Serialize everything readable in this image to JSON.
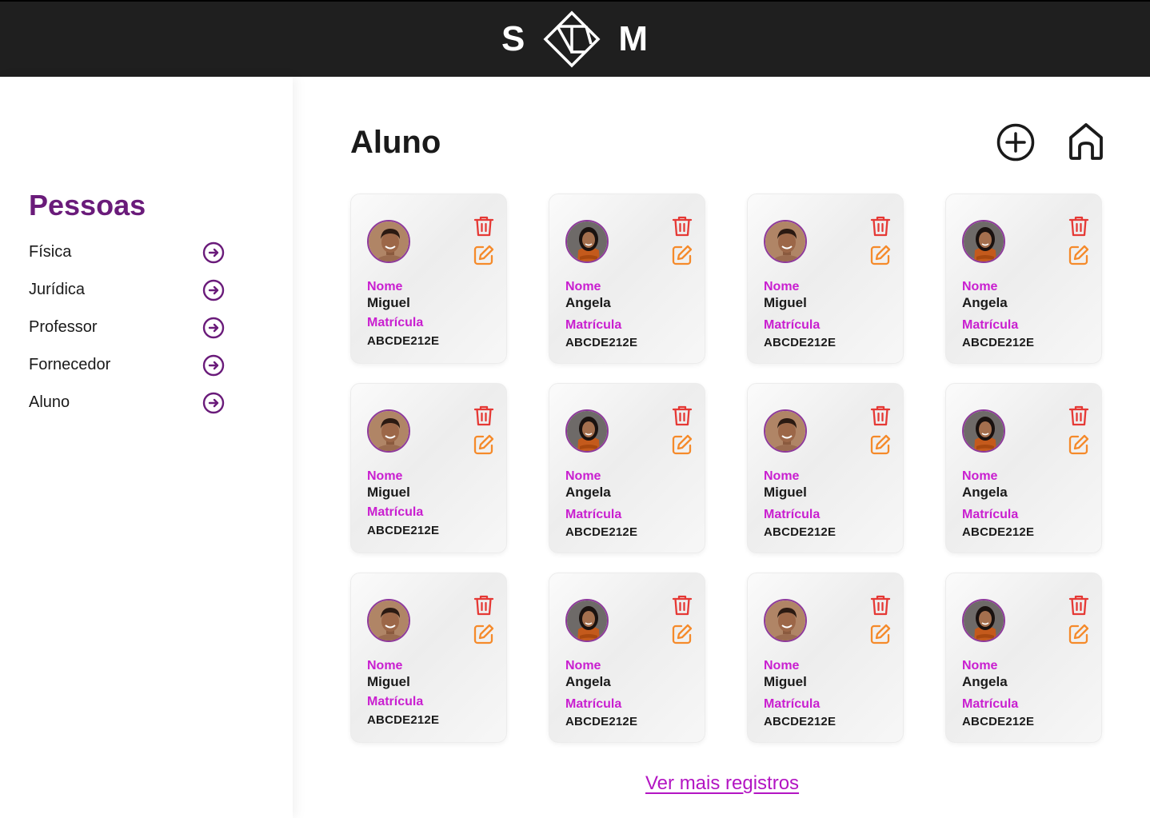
{
  "header": {
    "logo_left": "S",
    "logo_right": "M"
  },
  "sidebar": {
    "title": "Pessoas",
    "items": [
      {
        "label": "Física"
      },
      {
        "label": "Jurídica"
      },
      {
        "label": "Professor"
      },
      {
        "label": "Fornecedor"
      },
      {
        "label": "Aluno"
      }
    ]
  },
  "main": {
    "title": "Aluno",
    "add_icon": "plus-circle-icon",
    "home_icon": "home-icon",
    "more_link": "Ver mais registros"
  },
  "cards": [
    {
      "name_label": "Nome",
      "name": "Miguel",
      "mat_label": "Matrícula",
      "matricula": "ABCDE212E",
      "avatar": "male"
    },
    {
      "name_label": "Nome",
      "name": "Angela",
      "mat_label": "Matrícula",
      "matricula": "ABCDE212E",
      "avatar": "female"
    },
    {
      "name_label": "Nome",
      "name": "Miguel",
      "mat_label": "Matrícula",
      "matricula": "ABCDE212E",
      "avatar": "male"
    },
    {
      "name_label": "Nome",
      "name": "Angela",
      "mat_label": "Matrícula",
      "matricula": "ABCDE212E",
      "avatar": "female"
    },
    {
      "name_label": "Nome",
      "name": "Miguel",
      "mat_label": "Matrícula",
      "matricula": "ABCDE212E",
      "avatar": "male"
    },
    {
      "name_label": "Nome",
      "name": "Angela",
      "mat_label": "Matrícula",
      "matricula": "ABCDE212E",
      "avatar": "female"
    },
    {
      "name_label": "Nome",
      "name": "Miguel",
      "mat_label": "Matrícula",
      "matricula": "ABCDE212E",
      "avatar": "male"
    },
    {
      "name_label": "Nome",
      "name": "Angela",
      "mat_label": "Matrícula",
      "matricula": "ABCDE212E",
      "avatar": "female"
    },
    {
      "name_label": "Nome",
      "name": "Miguel",
      "mat_label": "Matrícula",
      "matricula": "ABCDE212E",
      "avatar": "male"
    },
    {
      "name_label": "Nome",
      "name": "Angela",
      "mat_label": "Matrícula",
      "matricula": "ABCDE212E",
      "avatar": "female"
    },
    {
      "name_label": "Nome",
      "name": "Miguel",
      "mat_label": "Matrícula",
      "matricula": "ABCDE212E",
      "avatar": "male"
    },
    {
      "name_label": "Nome",
      "name": "Angela",
      "mat_label": "Matrícula",
      "matricula": "ABCDE212E",
      "avatar": "female"
    }
  ],
  "colors": {
    "accent": "#6a1b7a",
    "label": "#c91fd0",
    "trash": "#e53935",
    "edit": "#f58a2a",
    "header_bg": "#1f1f1f"
  }
}
